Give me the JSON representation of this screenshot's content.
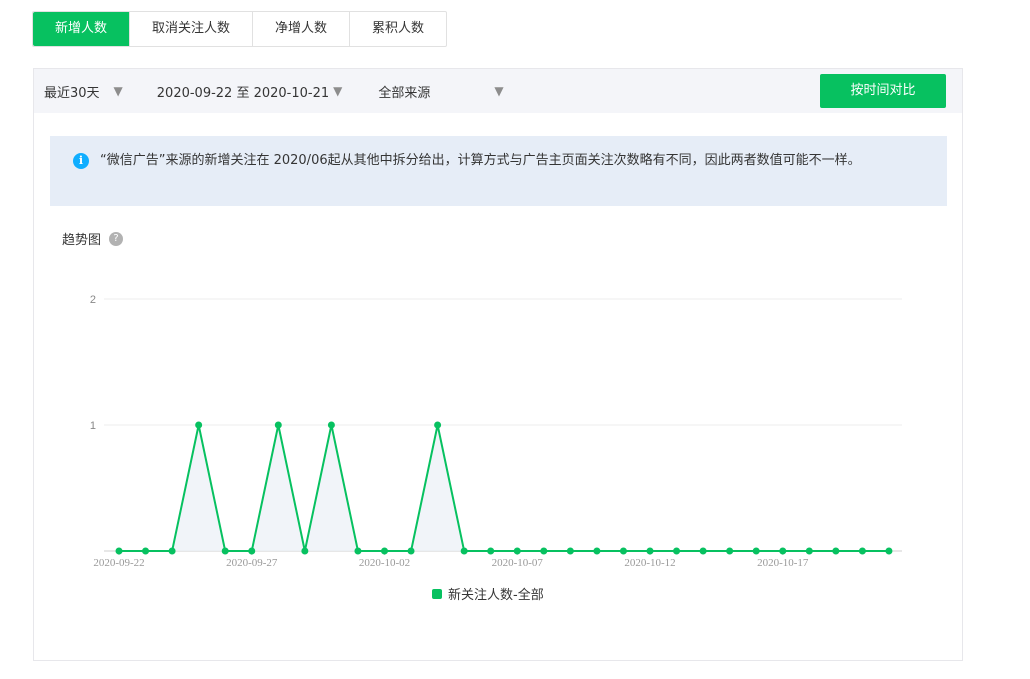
{
  "tabs": [
    {
      "label": "新增人数",
      "active": true
    },
    {
      "label": "取消关注人数",
      "active": false
    },
    {
      "label": "净增人数",
      "active": false
    },
    {
      "label": "累积人数",
      "active": false
    }
  ],
  "filters": {
    "period": "最近30天",
    "date_range": "2020-09-22 至 2020-10-21",
    "source": "全部来源"
  },
  "compare_button": "按时间对比",
  "notice": "“微信广告”来源的新增关注在 2020/06起从其他中拆分给出，计算方式与广告主页面关注次数略有不同，因此两者数值可能不一样。",
  "trend_title": "趋势图",
  "colors": {
    "accent": "#07c160",
    "notice_bg": "#e6edf7",
    "info": "#10aeff"
  },
  "chart_data": {
    "type": "line",
    "x": [
      "2020-09-22",
      "2020-09-23",
      "2020-09-24",
      "2020-09-25",
      "2020-09-26",
      "2020-09-27",
      "2020-09-28",
      "2020-09-29",
      "2020-09-30",
      "2020-10-01",
      "2020-10-02",
      "2020-10-03",
      "2020-10-04",
      "2020-10-05",
      "2020-10-06",
      "2020-10-07",
      "2020-10-08",
      "2020-10-09",
      "2020-10-10",
      "2020-10-11",
      "2020-10-12",
      "2020-10-13",
      "2020-10-14",
      "2020-10-15",
      "2020-10-16",
      "2020-10-17",
      "2020-10-18",
      "2020-10-19",
      "2020-10-20",
      "2020-10-21"
    ],
    "x_tick_labels": [
      "2020-09-22",
      "2020-09-27",
      "2020-10-02",
      "2020-10-07",
      "2020-10-12",
      "2020-10-17"
    ],
    "y_ticks": [
      1,
      2
    ],
    "ylim": [
      0,
      2
    ],
    "series": [
      {
        "name": "新关注人数-全部",
        "values": [
          0,
          0,
          0,
          1,
          0,
          0,
          1,
          0,
          1,
          0,
          0,
          0,
          1,
          0,
          0,
          0,
          0,
          0,
          0,
          0,
          0,
          0,
          0,
          0,
          0,
          0,
          0,
          0,
          0,
          0
        ]
      }
    ],
    "grid": true,
    "legend": "bottom"
  }
}
